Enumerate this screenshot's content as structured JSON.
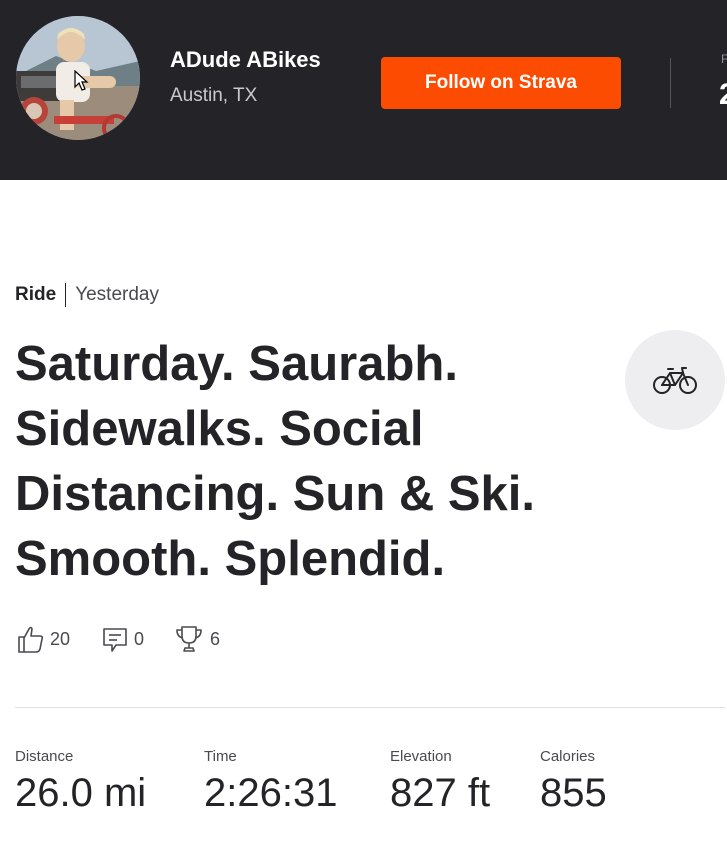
{
  "header": {
    "athlete_name": "ADude ABikes",
    "location": "Austin, TX",
    "follow_label": "Follow on Strava",
    "stat_label_partial": "F",
    "stat_value_partial": "2",
    "background": "#242428",
    "accent": "#fc4c02"
  },
  "activity": {
    "type": "Ride",
    "date": "Yesterday",
    "title": "Saturday. Saurabh. Sidewalks. Social Distancing. Sun & Ski. Smooth. Splendid.",
    "sport_icon": "bike-icon"
  },
  "social": {
    "kudos": "20",
    "comments": "0",
    "achievements": "6"
  },
  "stats": [
    {
      "label": "Distance",
      "value": "26.0 mi"
    },
    {
      "label": "Time",
      "value": "2:26:31"
    },
    {
      "label": "Elevation",
      "value": "827 ft"
    },
    {
      "label": "Calories",
      "value": "855"
    }
  ]
}
